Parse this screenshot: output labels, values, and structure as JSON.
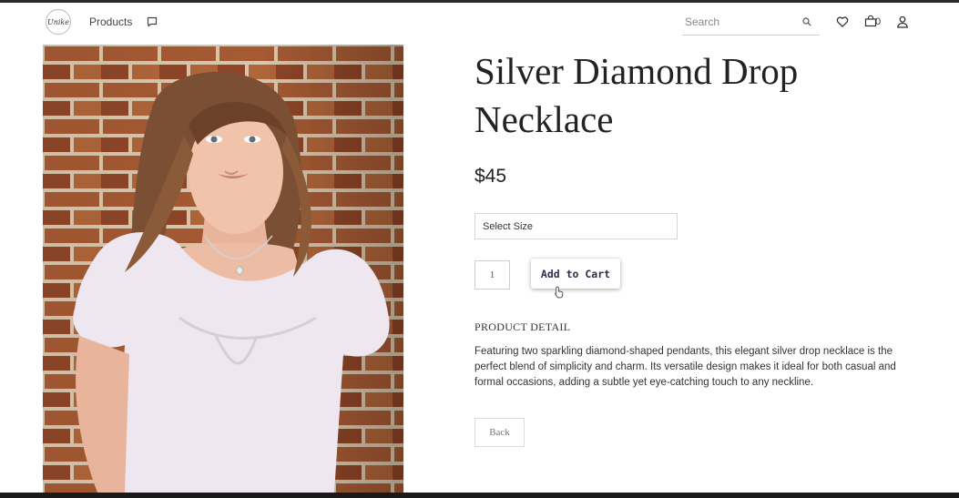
{
  "header": {
    "logo_text": "Unike",
    "nav_products_label": "Products",
    "search_placeholder": "Search",
    "cart_count": "0"
  },
  "product": {
    "title": "Silver Diamond Drop Necklace",
    "price": "$45",
    "size_select_label": "Select Size",
    "quantity": "1",
    "add_to_cart_label": "Add to Cart",
    "detail_heading": "PRODUCT DETAIL",
    "detail_text": "Featuring two sparkling diamond-shaped pendants, this elegant silver drop necklace is the perfect blend of simplicity and charm. Its versatile design makes it ideal for both casual and formal occasions, adding a subtle yet eye-catching touch to any neckline.",
    "back_label": "Back"
  },
  "icons": {
    "chat": "chat-icon",
    "search": "search-icon",
    "wishlist": "heart-icon",
    "cart": "shopping-bag-icon",
    "account": "user-icon"
  }
}
